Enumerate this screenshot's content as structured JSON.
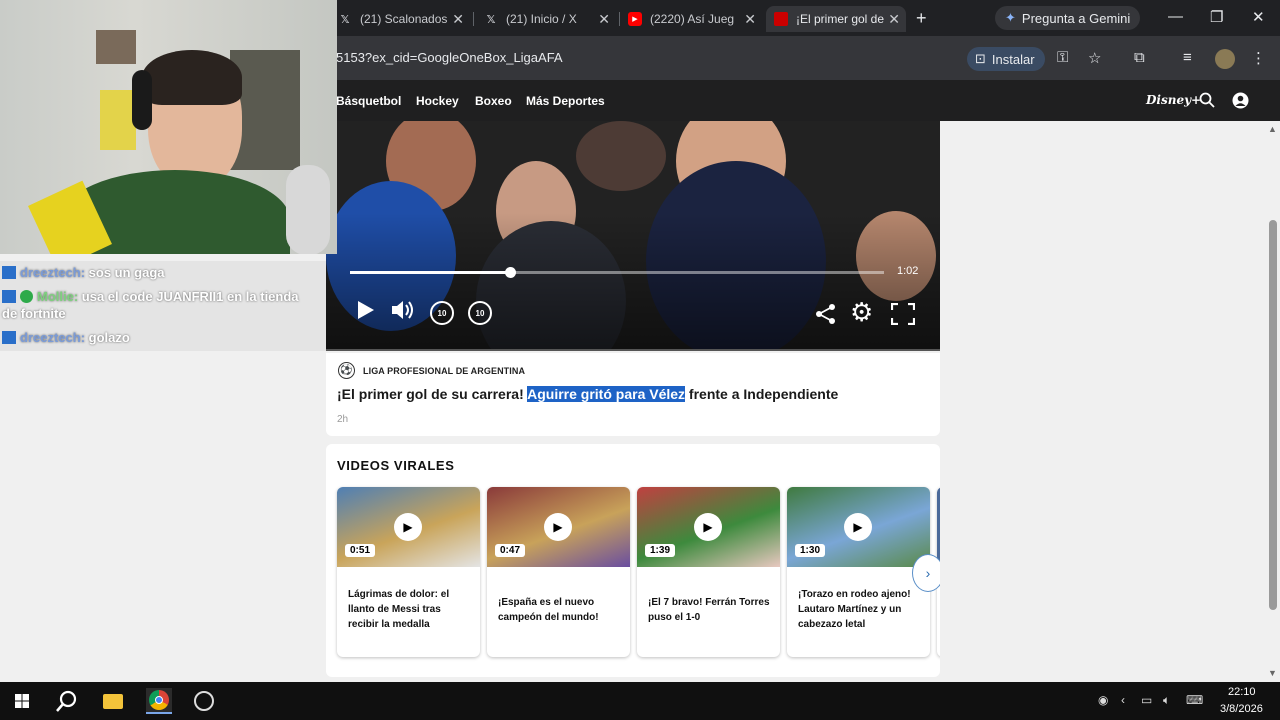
{
  "browser": {
    "tabs": [
      {
        "label": "(21) Scalonados",
        "icon": "x-logo-icon"
      },
      {
        "label": "(21) Inicio / X",
        "icon": "x-logo-icon"
      },
      {
        "label": "(2220) Así Jueg",
        "icon": "youtube-icon"
      },
      {
        "label": "¡El primer gol de",
        "icon": "espn-icon",
        "active": true
      }
    ],
    "new_tab": "+",
    "gemini_label": "Pregunta a Gemini",
    "url": "5153?ex_cid=GoogleOneBox_LigaAFA",
    "install_label": "Instalar"
  },
  "site_nav": {
    "items": [
      "Básquetbol",
      "Hockey",
      "Boxeo",
      "Más Deportes"
    ],
    "disney_label": "Disney+"
  },
  "video": {
    "duration": "1:02",
    "progress_fraction": 0.3,
    "skip_back": "10",
    "skip_forward": "10"
  },
  "article": {
    "league": "LIGA PROFESIONAL DE ARGENTINA",
    "headline_before": "¡El primer gol de su carrera! ",
    "headline_highlight": "Aguirre gritó para Vélez",
    "headline_after": " frente a Independiente",
    "age": "2h"
  },
  "virales": {
    "title": "VIDEOS VIRALES",
    "videos": [
      {
        "duration": "0:51",
        "title": "Lágrimas de dolor: el llanto de Messi tras recibir la medalla",
        "colors": [
          "#4f7fb4",
          "#c9a45a",
          "#e4e4e4"
        ]
      },
      {
        "duration": "0:47",
        "title": "¡España es el nuevo campeón del mundo!",
        "colors": [
          "#8a3a3a",
          "#c8a25a",
          "#6a4ea0"
        ]
      },
      {
        "duration": "1:39",
        "title": "¡El 7 bravo! Ferrán Torres puso el 1-0",
        "colors": [
          "#c04040",
          "#3d8a3d",
          "#e8c8c0"
        ]
      },
      {
        "duration": "1:30",
        "title": "¡Torazo en rodeo ajeno! Lautaro Martínez y un cabezazo letal",
        "colors": [
          "#3f7a3f",
          "#7aa6d6",
          "#5a8a4a"
        ]
      }
    ]
  },
  "chat": [
    {
      "user": "dreeztech:",
      "message": "sos un gaga",
      "verified": false
    },
    {
      "user": "Mollie:",
      "message": "usa el code JUANFRII1 en la tienda",
      "continuation": "de fortnite",
      "verified": true
    },
    {
      "user": "dreeztech:",
      "message": "golazo",
      "verified": false
    }
  ],
  "taskbar": {
    "time": "22:10",
    "date": "3/8/2026"
  },
  "colors": {
    "highlight": "#1e63c6",
    "nav_bg": "#1f1f20",
    "tab_bg": "#202124"
  }
}
